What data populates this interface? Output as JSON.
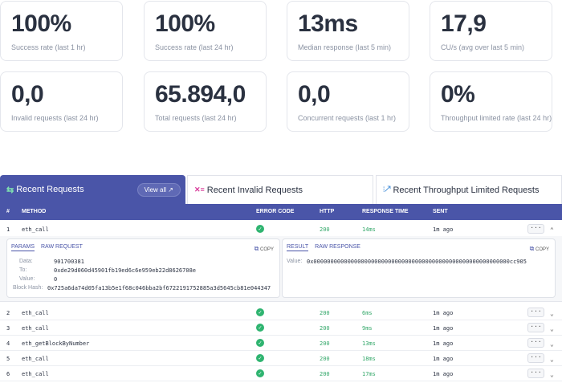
{
  "stats": [
    {
      "value": "100%",
      "label": "Success rate (last 1 hr)"
    },
    {
      "value": "100%",
      "label": "Success rate (last 24 hr)"
    },
    {
      "value": "13ms",
      "label": "Median response (last 5 min)"
    },
    {
      "value": "17,9",
      "label": "CU/s (avg over last 5 min)"
    },
    {
      "value": "0,0",
      "label": "Invalid requests (last 24 hr)"
    },
    {
      "value": "65.894,0",
      "label": "Total requests (last 24 hr)"
    },
    {
      "value": "0,0",
      "label": "Concurrent requests (last 1 hr)"
    },
    {
      "value": "0%",
      "label": "Throughput limited rate (last 24 hr)"
    }
  ],
  "tabs": [
    {
      "label": "Recent Requests",
      "icon": "⇆"
    },
    {
      "label": "Recent Invalid Requests",
      "icon": "✕≡"
    },
    {
      "label": "Recent Throughput Limited Requests",
      "icon": "⫶↗"
    }
  ],
  "view_all": "View all ↗",
  "columns": {
    "num": "#",
    "method": "METHOD",
    "error": "ERROR CODE",
    "http": "HTTP",
    "time": "RESPONSE TIME",
    "sent": "SENT"
  },
  "rows": [
    {
      "num": "1",
      "method": "eth_call",
      "http": "200",
      "time": "14ms",
      "sent": "1m ago"
    },
    {
      "num": "2",
      "method": "eth_call",
      "http": "200",
      "time": "6ms",
      "sent": "1m ago"
    },
    {
      "num": "3",
      "method": "eth_call",
      "http": "200",
      "time": "9ms",
      "sent": "1m ago"
    },
    {
      "num": "4",
      "method": "eth_getBlockByNumber",
      "http": "200",
      "time": "13ms",
      "sent": "1m ago"
    },
    {
      "num": "5",
      "method": "eth_call",
      "http": "200",
      "time": "18ms",
      "sent": "1m ago"
    },
    {
      "num": "6",
      "method": "eth_call",
      "http": "200",
      "time": "17ms",
      "sent": "1m ago"
    }
  ],
  "detail": {
    "params_tab": "PARAMS",
    "raw_request_tab": "RAW REQUEST",
    "result_tab": "RESULT",
    "raw_response_tab": "RAW RESPONSE",
    "copy": "COPY",
    "params": [
      {
        "key": "Data:",
        "value": "901700381"
      },
      {
        "key": "To:",
        "value": "0xde29d060d45901fb19ed6c6e959eb22d8626708e"
      },
      {
        "key": "Value:",
        "value": "0"
      },
      {
        "key": "Block Hash:",
        "value": "0x725a6da74d05fa13b5e1f68c046bba2bf6722191752885a3d5645cb81e044347"
      }
    ],
    "result_key": "Value:",
    "result_value": "0x0000000000000000000000000000000000000000000000000000000000cc905"
  },
  "more": "···",
  "chevron_down": "⌄",
  "chevron_up": "⌃",
  "check": "✓",
  "colors": {
    "accent": "#4a55a8",
    "success": "#2fb470",
    "http_text": "#34a86a"
  }
}
